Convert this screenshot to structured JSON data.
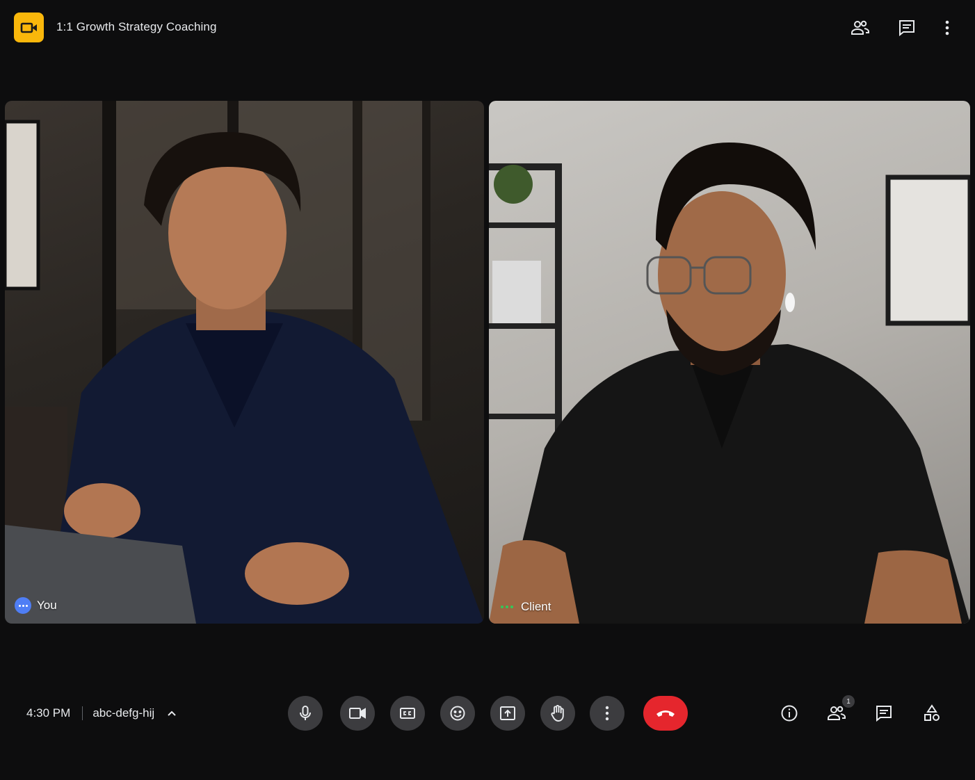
{
  "header": {
    "meeting_title": "1:1 Growth Strategy Coaching",
    "logo_icon": "video-camera-icon",
    "logo_color": "#f9b70b",
    "actions": [
      {
        "icon": "people-icon"
      },
      {
        "icon": "chat-icon"
      },
      {
        "icon": "more-vert-icon"
      }
    ]
  },
  "participants": [
    {
      "label": "You",
      "indicator": "speaking-dots-blue",
      "indicator_color": "#4f7ef5"
    },
    {
      "label": "Client",
      "indicator": "speaking-dots-green",
      "indicator_color": "#34c759"
    }
  ],
  "footer": {
    "time": "4:30 PM",
    "meeting_code": "abc-defg-hij",
    "controls": [
      {
        "icon": "microphone-icon"
      },
      {
        "icon": "camera-icon"
      },
      {
        "icon": "closed-captions-icon"
      },
      {
        "icon": "emoji-icon"
      },
      {
        "icon": "present-screen-icon"
      },
      {
        "icon": "raise-hand-icon"
      },
      {
        "icon": "more-vert-icon"
      },
      {
        "icon": "end-call-icon",
        "color": "#e5262d"
      }
    ],
    "right_actions": [
      {
        "icon": "info-icon"
      },
      {
        "icon": "people-icon",
        "badge": "1"
      },
      {
        "icon": "chat-icon"
      },
      {
        "icon": "activities-icon"
      }
    ]
  }
}
